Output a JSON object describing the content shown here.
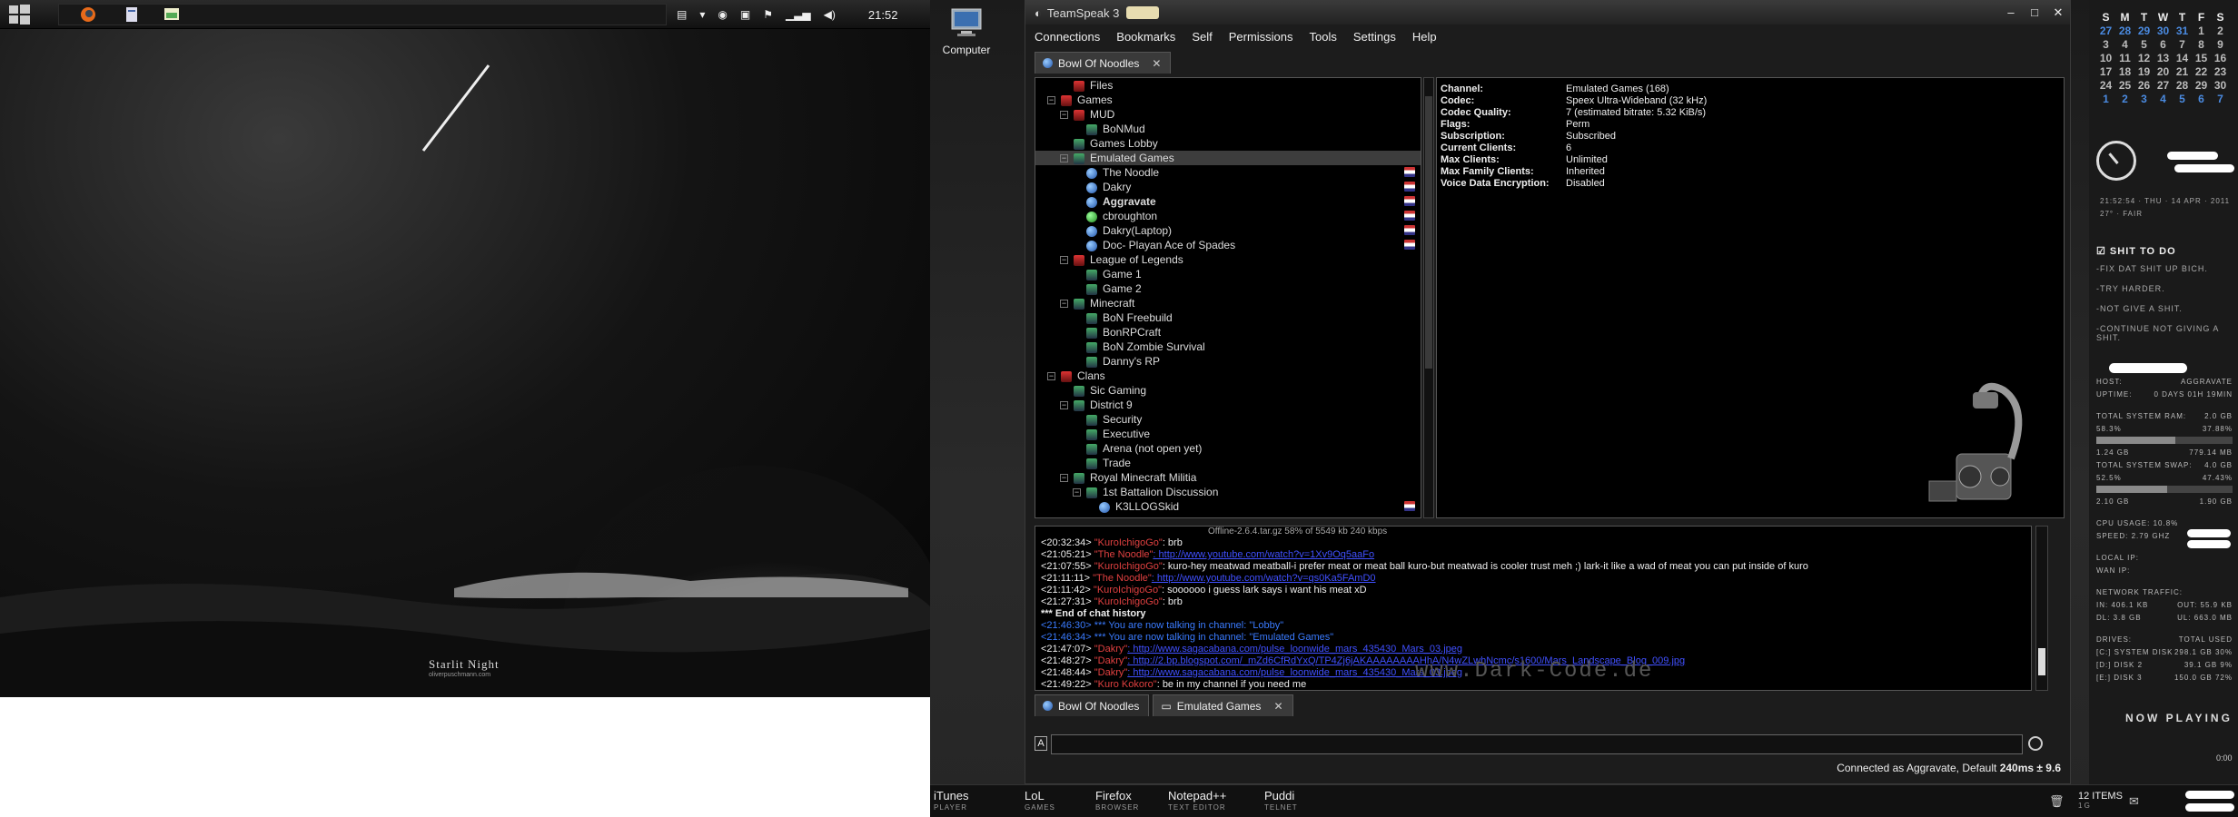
{
  "left_taskbar": {
    "clock": "21:52"
  },
  "wallpaper": {
    "caption": "Starlit Night",
    "subcaption": "oliverpuschmann.com"
  },
  "desktop": {
    "computer_label": "Computer"
  },
  "teamspeak": {
    "title": "TeamSpeak 3",
    "menu": [
      "Connections",
      "Bookmarks",
      "Self",
      "Permissions",
      "Tools",
      "Settings",
      "Help"
    ],
    "server_tab": "Bowl Of Noodles",
    "tree": [
      {
        "label": "Files",
        "indent": 2,
        "exp": "",
        "icon": "r"
      },
      {
        "label": "Games",
        "indent": 1,
        "exp": "−",
        "icon": "r"
      },
      {
        "label": "MUD",
        "indent": 2,
        "exp": "−",
        "icon": "r"
      },
      {
        "label": "BoNMud",
        "indent": 3,
        "exp": "",
        "icon": "c"
      },
      {
        "label": "Games Lobby",
        "indent": 2,
        "exp": "",
        "icon": "c"
      },
      {
        "label": "Emulated Games",
        "indent": 2,
        "exp": "−",
        "icon": "c",
        "selected": true
      },
      {
        "label": "The Noodle",
        "indent": 3,
        "exp": "",
        "icon": "u"
      },
      {
        "label": "Dakry",
        "indent": 3,
        "exp": "",
        "icon": "u"
      },
      {
        "label": "Aggravate",
        "indent": 3,
        "exp": "",
        "icon": "u",
        "bold": true
      },
      {
        "label": "cbroughton",
        "indent": 3,
        "exp": "",
        "icon": "g"
      },
      {
        "label": "Dakry(Laptop)",
        "indent": 3,
        "exp": "",
        "icon": "u"
      },
      {
        "label": "Doc- Playan Ace of Spades",
        "indent": 3,
        "exp": "",
        "icon": "u"
      },
      {
        "label": "League of Legends",
        "indent": 2,
        "exp": "−",
        "icon": "r"
      },
      {
        "label": "Game 1",
        "indent": 3,
        "exp": "",
        "icon": "c"
      },
      {
        "label": "Game 2",
        "indent": 3,
        "exp": "",
        "icon": "c"
      },
      {
        "label": "Minecraft",
        "indent": 2,
        "exp": "−",
        "icon": "c"
      },
      {
        "label": "BoN Freebuild",
        "indent": 3,
        "exp": "",
        "icon": "c"
      },
      {
        "label": "BonRPCraft",
        "indent": 3,
        "exp": "",
        "icon": "c"
      },
      {
        "label": "BoN Zombie Survival",
        "indent": 3,
        "exp": "",
        "icon": "c"
      },
      {
        "label": "Danny's RP",
        "indent": 3,
        "exp": "",
        "icon": "c"
      },
      {
        "label": "Clans",
        "indent": 1,
        "exp": "−",
        "icon": "r"
      },
      {
        "label": "Sic Gaming",
        "indent": 2,
        "exp": "",
        "icon": "c"
      },
      {
        "label": "District 9",
        "indent": 2,
        "exp": "−",
        "icon": "c"
      },
      {
        "label": "Security",
        "indent": 3,
        "exp": "",
        "icon": "c"
      },
      {
        "label": "Executive",
        "indent": 3,
        "exp": "",
        "icon": "c"
      },
      {
        "label": "Arena (not open yet)",
        "indent": 3,
        "exp": "",
        "icon": "c"
      },
      {
        "label": "Trade",
        "indent": 3,
        "exp": "",
        "icon": "c"
      },
      {
        "label": "Royal Minecraft Militia",
        "indent": 2,
        "exp": "−",
        "icon": "c"
      },
      {
        "label": "1st Battalion Discussion",
        "indent": 3,
        "exp": "−",
        "icon": "c"
      },
      {
        "label": "K3LLOGSkid",
        "indent": 4,
        "exp": "",
        "icon": "u"
      }
    ],
    "info": [
      {
        "k": "Channel:",
        "v": "Emulated Games (168)"
      },
      {
        "k": "Codec:",
        "v": "Speex Ultra-Wideband (32 kHz)"
      },
      {
        "k": "Codec Quality:",
        "v": "7 (estimated bitrate: 5.32 KiB/s)"
      },
      {
        "k": "Flags:",
        "v": "Perm"
      },
      {
        "k": "Subscription:",
        "v": "Subscribed"
      },
      {
        "k": "Current Clients:",
        "v": "6"
      },
      {
        "k": "Max Clients:",
        "v": "Unlimited"
      },
      {
        "k": "Max Family Clients:",
        "v": "Inherited"
      },
      {
        "k": "Voice Data Encryption:",
        "v": "Disabled"
      }
    ],
    "chat_top": "Offline-2.6.4.tar.gz                 58% of 5549 kb   240 kbps",
    "chat": [
      {
        "t": "<20:32:34>",
        "n": "\"KuroIchigoGo\"",
        "m": ": brb",
        "type": "msg"
      },
      {
        "t": "<21:05:21>",
        "n": "\"The Noodle\"",
        "m": ": http://www.youtube.com/watch?v=1Xv9Oq5aaFo",
        "type": "link"
      },
      {
        "t": "<21:07:55>",
        "n": "\"KuroIchigoGo\"",
        "m": ": kuro-hey meatwad meatball-i prefer meat or meat ball kuro-but meatwad is cooler trust meh ;) lark-it like a wad of meat you can put inside of kuro",
        "type": "msg"
      },
      {
        "t": "<21:11:11>",
        "n": "\"The Noodle\"",
        "m": ": http://www.youtube.com/watch?v=qs0Ka5FAmD0",
        "type": "link"
      },
      {
        "t": "<21:11:42>",
        "n": "\"KuroIchigoGo\"",
        "m": ": soooooo i guess lark says i want his meat xD",
        "type": "msg"
      },
      {
        "t": "<21:27:31>",
        "n": "\"KuroIchigoGo\"",
        "m": ": brb",
        "type": "msg"
      },
      {
        "t": "",
        "n": "",
        "m": "*** End of chat history",
        "type": "bold"
      },
      {
        "t": "<21:46:30>",
        "n": "",
        "m": "*** You are now talking in channel: \"Lobby\"",
        "type": "sys"
      },
      {
        "t": "<21:46:34>",
        "n": "",
        "m": "*** You are now talking in channel: \"Emulated Games\"",
        "type": "sys"
      },
      {
        "t": "<21:47:07>",
        "n": "\"Dakry\"",
        "m": ": http://www.sagacabana.com/pulse_loonwide_mars_435430_Mars_03.jpeg",
        "type": "link"
      },
      {
        "t": "<21:48:27>",
        "n": "\"Dakry\"",
        "m": ": http://2.bp.blogspot.com/_mZd6CfRdYxQ/TP4Zj6jAKAAAAAAAAHhA/N4wZLwhNcmc/s1600/Mars_Landscape_Blog_009.jpg",
        "type": "link"
      },
      {
        "t": "<21:48:44>",
        "n": "\"Dakry\"",
        "m": ": http://www.sagacabana.com/pulse_loonwide_mars_435430_Mars_03.jpeg",
        "type": "link"
      },
      {
        "t": "<21:49:22>",
        "n": "\"Kuro Kokoro\"",
        "m": ": be in my channel if you need me",
        "type": "msg"
      }
    ],
    "watermark": "www.Dark-Code.de",
    "chat_tabs": [
      "Bowl Of Noodles",
      "Emulated Games"
    ],
    "status": "Connected as Aggravate, Default",
    "ping": "240ms ± 9.6"
  },
  "taskbar_right": {
    "items": [
      {
        "label": "iTunes",
        "sub": "PLAYER"
      },
      {
        "label": "LoL",
        "sub": "GAMES"
      },
      {
        "label": "Firefox",
        "sub": "BROWSER"
      },
      {
        "label": "Notepad++",
        "sub": "TEXT EDITOR"
      },
      {
        "label": "Puddi",
        "sub": "TELNET"
      }
    ],
    "items_count": "12 ITEMS",
    "items_size": "1 G"
  },
  "sidebar": {
    "cal_header": [
      "S",
      "M",
      "T",
      "W",
      "T",
      "F",
      "S"
    ],
    "cal_weeks": [
      [
        "27",
        "28",
        "29",
        "30",
        "31",
        "1",
        "2"
      ],
      [
        "3",
        "4",
        "5",
        "6",
        "7",
        "8",
        "9"
      ],
      [
        "10",
        "11",
        "12",
        "13",
        "14",
        "15",
        "16"
      ],
      [
        "17",
        "18",
        "19",
        "20",
        "21",
        "22",
        "23"
      ],
      [
        "24",
        "25",
        "26",
        "27",
        "28",
        "29",
        "30"
      ],
      [
        "1",
        "2",
        "3",
        "4",
        "5",
        "6",
        "7"
      ]
    ],
    "clock_line": "21:52:54  ·  THU  ·  14 APR  ·  2011",
    "weather": "27° · FAIR",
    "todo_title": "SHIT TO DO",
    "todo_items": [
      "-FIX DAT SHIT UP BICH.",
      "-TRY HARDER.",
      "-NOT GIVE A SHIT.",
      "-CONTINUE NOT GIVING A SHIT."
    ],
    "sys_rows": [
      {
        "l": "HOST:",
        "r": "AGGRAVATE"
      },
      {
        "l": "UPTIME:",
        "r": "0 DAYS 01H 19MIN"
      },
      {
        "l": "TOTAL SYSTEM RAM:",
        "r": "2.0 GB"
      },
      {
        "l": "58.3%",
        "r": "37.88%",
        "bar": 0.58
      },
      {
        "l": "1.24 GB",
        "r": "779.14 MB"
      },
      {
        "l": "TOTAL SYSTEM SWAP:",
        "r": "4.0 GB"
      },
      {
        "l": "52.5%",
        "r": "47.43%",
        "bar": 0.52
      },
      {
        "l": "2.10 GB",
        "r": "1.90 GB"
      },
      {
        "l": "CPU USAGE: 10.8%",
        "r": ""
      },
      {
        "l": "SPEED: 2.79 GHZ",
        "r": ""
      },
      {
        "l": "LOCAL IP:",
        "r": ""
      },
      {
        "l": "WAN IP:",
        "r": ""
      },
      {
        "l": "NETWORK TRAFFIC:",
        "r": ""
      },
      {
        "l": "IN: 406.1 KB",
        "r": "OUT: 55.9 KB"
      },
      {
        "l": "DL: 3.8 GB",
        "r": "UL: 663.0 MB"
      },
      {
        "l": "DRIVES:",
        "r": "TOTAL    USED"
      },
      {
        "l": "[C:] SYSTEM DISK",
        "r": "298.1 GB    30%"
      },
      {
        "l": "[D:] DISK 2",
        "r": "39.1 GB    9%"
      },
      {
        "l": "[E:] DISK 3",
        "r": "150.0 GB    72%"
      }
    ],
    "now_playing": "NOW PLAYING",
    "now_playing_val": "0:00"
  }
}
